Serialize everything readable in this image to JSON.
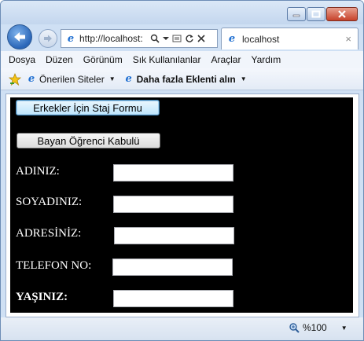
{
  "browser": {
    "address": {
      "url": "http://localhost:"
    },
    "tab": {
      "title": "localhost",
      "close_glyph": "×"
    },
    "menu": [
      "Dosya",
      "Düzen",
      "Görünüm",
      "Sık Kullanılanlar",
      "Araçlar",
      "Yardım"
    ],
    "favorites": {
      "suggested": "Önerilen Siteler",
      "addons": "Daha fazla Eklenti alın"
    },
    "status": {
      "zoom": "%100"
    }
  },
  "page": {
    "buttons": {
      "internship": "Erkekler İçin Staj Formu",
      "female_admission": "Bayan Öğrenci Kabulü"
    },
    "form": {
      "name_label": "ADINIZ:",
      "surname_label": "SOYADINIZ:",
      "address_label": "ADRESİNİZ:",
      "phone_label": "TELEFON NO:",
      "age_label": "YAŞINIZ:",
      "name_value": "",
      "surname_value": "",
      "address_value": "",
      "phone_value": "",
      "age_value": ""
    },
    "background_color": "#000000",
    "label_color": "#ffffff"
  }
}
